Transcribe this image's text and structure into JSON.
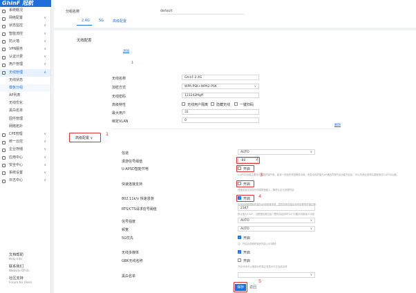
{
  "app": {
    "logo": "GhinF 冠航"
  },
  "sidebar": {
    "items": [
      {
        "label": "系统概况",
        "icon": "home-icon"
      },
      {
        "label": "网络配置",
        "icon": "network-icon",
        "chevron": "∨"
      },
      {
        "label": "状态监控",
        "icon": "monitor-icon",
        "chevron": "∨"
      },
      {
        "label": "智能流控",
        "icon": "flow-icon",
        "chevron": "∨"
      },
      {
        "label": "防火墙",
        "icon": "firewall-icon",
        "chevron": "∨"
      },
      {
        "label": "VPN服务",
        "icon": "vpn-icon",
        "chevron": "∨"
      },
      {
        "label": "认证计费",
        "icon": "auth-icon",
        "chevron": "∨"
      },
      {
        "label": "用户管理",
        "icon": "user-icon",
        "chevron": "∨"
      },
      {
        "label": "无线管理",
        "icon": "wifi-icon",
        "chevron": "∧"
      }
    ],
    "subitems": [
      "无线状态",
      "模板分组",
      "AP列表",
      "无线优化",
      "黑白名单",
      "固件管理",
      "网络拓扑"
    ],
    "items2": [
      {
        "label": "CPE管理",
        "icon": "cpe-icon",
        "chevron": "∨"
      },
      {
        "label": "统一云控",
        "icon": "cloud-icon",
        "chevron": "∨"
      },
      {
        "label": "企业存储",
        "icon": "storage-icon",
        "chevron": "∨"
      },
      {
        "label": "应用中心",
        "icon": "apps-icon",
        "chevron": "∨"
      },
      {
        "label": "安全中心",
        "icon": "shield-icon",
        "chevron": "∨"
      },
      {
        "label": "系统设置",
        "icon": "settings-icon",
        "chevron": "∨"
      },
      {
        "label": "日志中心",
        "icon": "log-icon",
        "chevron": "∨"
      }
    ],
    "help": [
      {
        "title": "文档帮助",
        "sub": "Help Info"
      },
      {
        "title": "联系我们",
        "sub": "Website Of Us"
      },
      {
        "title": "社区支持",
        "sub": "Forum for Users"
      }
    ]
  },
  "top": {
    "group_label": "分组名称",
    "group_value": "default",
    "tab_24": "2.4G",
    "tab_5": "5G",
    "tab_adv": "高级配置"
  },
  "wireless": {
    "section_title": "无线配置",
    "add_link": "添加",
    "index": "1",
    "ssid_label": "无线名称",
    "ssid_value": "GhinF-2.4G",
    "enc_label": "加密方式",
    "enc_value": "WPA-PSK+WPA2-PSK",
    "pwd_label": "无线密码",
    "pwd_value": "123242Mgff",
    "feature_label": "高级特性",
    "feature1": "无线用户隔离",
    "feature2": "隐藏无线",
    "feature3": "一键扫码",
    "maxuser_label": "最大用户",
    "maxuser_value": "31",
    "vlan_label": "绑定VLAN",
    "vlan_value": "0",
    "delete_link": "删除"
  },
  "advanced": {
    "toggle_label": "高级配置",
    "toggle_icon": "∨",
    "channel_label": "信道",
    "channel_value": "AUTO",
    "rssi_label": "漫游信号阈值",
    "rssi_value": "-80",
    "uapsd_label": "U-APSD智能节电",
    "uapsd_check": "开启",
    "uapsd_hint": "U-APSD功能主要用于智能终端节电，能将一些操作系统降低功耗，但若出现终端与AP通信异常时此功能开启后，可以关闭此选项后重新测试U-APSD功能。",
    "fast_label": "快速连接支持",
    "fast_check": "开启",
    "fast_hint": "快速连接支持用于终端快速接入，降低认证与关联时延",
    "kv_label": "802.11k/v 快速漫游",
    "kv_check": "开启",
    "kv_hint": "启用后能够帮助终端在AP间快速漫游，同时加快连接后信号较差的终端切换",
    "rts_label": "RTS/CTS请求信号阈值",
    "rts_value": "2347",
    "rts_hint": "默认值为2347，当数据包超过此门限时将启用RTS/CTS握手机制减少冲突",
    "power_label": "信号强度",
    "power_value": "AUTO",
    "bw_label": "频宽",
    "bw_value": "AUTO",
    "fivefirst_label": "5G优先",
    "fivefirst_check": "开启",
    "fivefirst_hint": "注：开启后双频终端优先接入5G频段",
    "mcast_label": "无线多媒体",
    "mcast_check": "开启",
    "gbk_label": "GBK无线名称",
    "gbk_check": "开启",
    "gbk_hint": "开启GBK可以使部分终端正常显示中文无线名称",
    "blacklist_label": "黑白名单",
    "save_button": "保存",
    "back_button": "返回"
  },
  "annotations": [
    "1",
    "2",
    "3",
    "4",
    "5"
  ]
}
